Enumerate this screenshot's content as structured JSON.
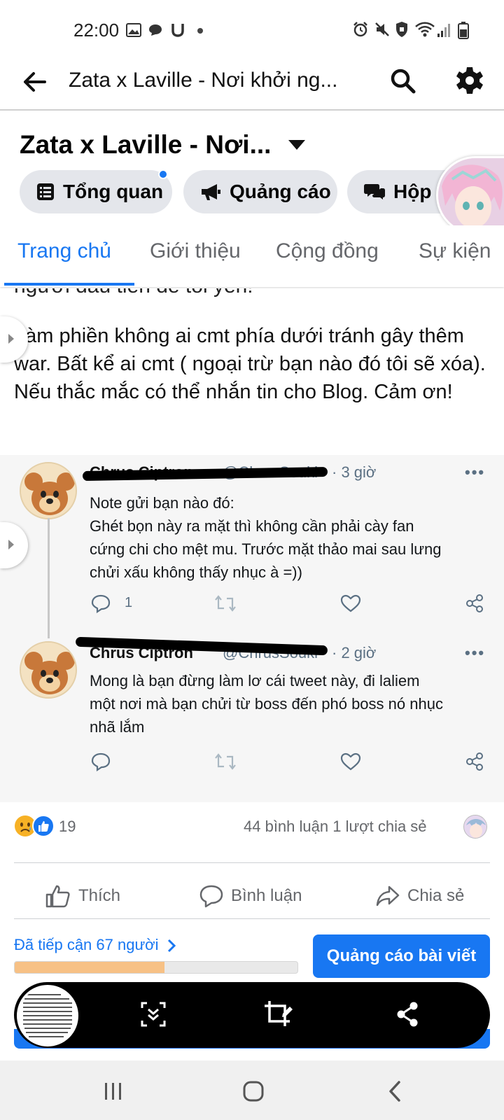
{
  "status_bar": {
    "time": "22:00",
    "left_icons": [
      "image-icon",
      "chat-bubble-icon",
      "u-icon",
      "dot-icon"
    ],
    "right_icons": [
      "alarm-icon",
      "mute-icon",
      "vpn-icon",
      "wifi-icon",
      "signal-icon",
      "battery-icon"
    ]
  },
  "app_bar": {
    "title": "Zata x Laville - Nơi khởi ng...",
    "icons": [
      "back-arrow-icon",
      "search-icon",
      "gear-icon"
    ]
  },
  "page_header": {
    "name": "Zata x Laville - Nơi...",
    "chips": [
      {
        "label": "Tổng quan",
        "icon": "list-icon"
      },
      {
        "label": "Quảng cáo",
        "icon": "megaphone-icon"
      },
      {
        "label": "Hộp t",
        "icon": "chat-icon"
      }
    ]
  },
  "tabs": [
    "Trang chủ",
    "Giới thiệu",
    "Cộng đồng",
    "Sự kiện"
  ],
  "post": {
    "cut_line": "người đầu tiên để tôi yên!",
    "body": "Làm phiền không ai cmt phía dưới tránh gây thêm war. Bất kể ai cmt ( ngoại trừ bạn nào đó tôi sẽ xóa). Nếu thắc mắc có thể nhắn tin cho Blog. Cảm ơn!"
  },
  "tweets": [
    {
      "name": "Chrus Ciptron",
      "handle": "@ChrusSouki",
      "time": "· 3 giờ",
      "more": "•••",
      "lines": [
        "Note gửi bạn nào đó:",
        "Ghét bọn này ra mặt thì không cần phải cày fan",
        "cứng chi cho mệt mu. Trước mặt thảo mai sau lưng",
        "chửi xấu không thấy nhục à =))"
      ],
      "reply_count": "1"
    },
    {
      "name": "Chrus Ciptron",
      "handle": "@ChrusSouki",
      "time": "· 2 giờ",
      "more": "•••",
      "lines": [
        "Mong là bạn đừng làm lơ cái tweet này, đi laliem",
        "một nơi mà bạn chửi từ boss đến phó boss nó nhục",
        "nhã lắm"
      ],
      "reply_count": ""
    }
  ],
  "reactions": {
    "count": "19",
    "comments_shares": "44 bình luận 1 lượt chia sẻ"
  },
  "actions": {
    "like": "Thích",
    "comment": "Bình luận",
    "share": "Chia sẻ"
  },
  "reach": {
    "label": "Đã tiếp cận 67 người",
    "progress_fraction": 0.53
  },
  "boost_button": "Quảng cáo bài viết",
  "colors": {
    "accent": "#1877f2",
    "text_secondary": "#65676b",
    "chip_bg": "#e4e6eb",
    "reach_fill": "#f7c185"
  }
}
